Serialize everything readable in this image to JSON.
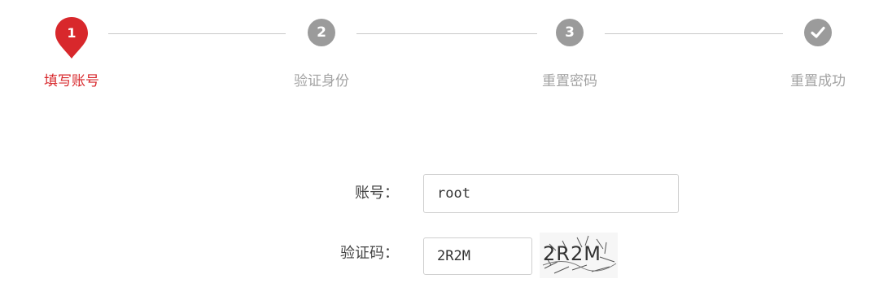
{
  "steps": [
    {
      "number": "1",
      "label": "填写账号",
      "state": "active"
    },
    {
      "number": "2",
      "label": "验证身份",
      "state": "pending"
    },
    {
      "number": "3",
      "label": "重置密码",
      "state": "pending"
    },
    {
      "number": "",
      "label": "重置成功",
      "state": "pending",
      "icon": "check-icon"
    }
  ],
  "form": {
    "account_label": "账号：",
    "account_value": "root",
    "captcha_label": "验证码：",
    "captcha_value": "2R2M",
    "captcha_image_text": "2R2M"
  },
  "colors": {
    "active": "#d8282c",
    "inactive": "#9b9b9b",
    "line": "#c8c8c8"
  }
}
